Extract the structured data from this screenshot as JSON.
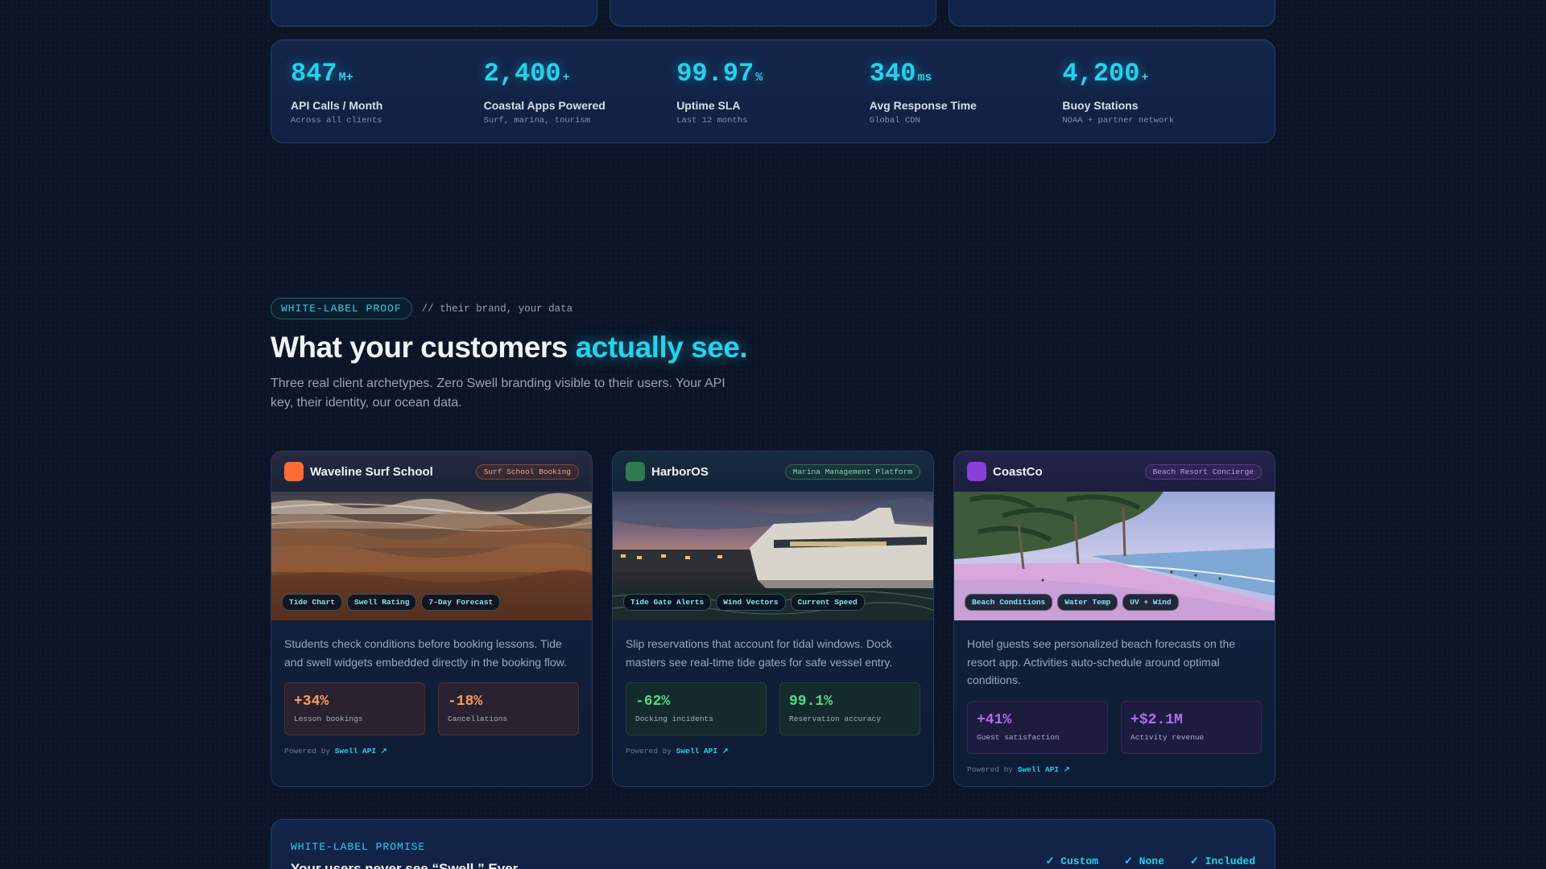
{
  "stats": [
    {
      "value": "847",
      "unit": "M+",
      "label": "API Calls / Month",
      "sub": "Across all clients"
    },
    {
      "value": "2,400",
      "unit": "+",
      "label": "Coastal Apps Powered",
      "sub": "Surf, marina, tourism"
    },
    {
      "value": "99.97",
      "unit": "%",
      "label": "Uptime SLA",
      "sub": "Last 12 months"
    },
    {
      "value": "340",
      "unit": "ms",
      "label": "Avg Response Time",
      "sub": "Global CDN"
    },
    {
      "value": "4,200",
      "unit": "+",
      "label": "Buoy Stations",
      "sub": "NOAA + partner network"
    }
  ],
  "section": {
    "eyebrow": "WHITE-LABEL PROOF",
    "comment": "// their brand, your data",
    "title_main": "What your customers ",
    "title_accent": "actually see.",
    "subtitle": "Three real client archetypes. Zero Swell branding visible to their users. Your API key, their identity, our ocean data."
  },
  "cards": [
    {
      "brand": "Waveline Surf School",
      "tag": "Surf School Booking",
      "logo_color": "#ff6b35",
      "chips": [
        "Tide Chart",
        "Swell Rating",
        "7-Day Forecast"
      ],
      "description": "Students check conditions before booking lessons. Tide and swell widgets embedded directly in the booking flow.",
      "metrics": [
        {
          "value": "+34%",
          "label": "Lesson bookings"
        },
        {
          "value": "-18%",
          "label": "Cancellations"
        }
      ],
      "powered_prefix": "Powered by",
      "powered_api": "Swell API ↗"
    },
    {
      "brand": "HarborOS",
      "tag": "Marina Management Platform",
      "logo_color": "#2f7a4f",
      "chips": [
        "Tide Gate Alerts",
        "Wind Vectors",
        "Current Speed"
      ],
      "description": "Slip reservations that account for tidal windows. Dock masters see real-time tide gates for safe vessel entry.",
      "metrics": [
        {
          "value": "-62%",
          "label": "Docking incidents"
        },
        {
          "value": "99.1%",
          "label": "Reservation accuracy"
        }
      ],
      "powered_prefix": "Powered by",
      "powered_api": "Swell API ↗"
    },
    {
      "brand": "CoastCo",
      "tag": "Beach Resort Concierge",
      "logo_color": "#8b3fd9",
      "chips": [
        "Beach Conditions",
        "Water Temp",
        "UV + Wind"
      ],
      "description": "Hotel guests see personalized beach forecasts on the resort app. Activities auto-schedule around optimal conditions.",
      "metrics": [
        {
          "value": "+41%",
          "label": "Guest satisfaction"
        },
        {
          "value": "+$2.1M",
          "label": "Activity revenue"
        }
      ],
      "powered_prefix": "Powered by",
      "powered_api": "Swell API ↗"
    }
  ],
  "promise": {
    "eyebrow": "WHITE-LABEL PROMISE",
    "title": "Your users never see “Swell.” Ever.",
    "checks": [
      "✓ Custom",
      "✓ None",
      "✓ Included"
    ]
  },
  "colors": {
    "accent": "#22d3ee",
    "surf_orange": "#ff9a5c",
    "harbor_green": "#4ade80",
    "resort_purple": "#b06cf0"
  }
}
